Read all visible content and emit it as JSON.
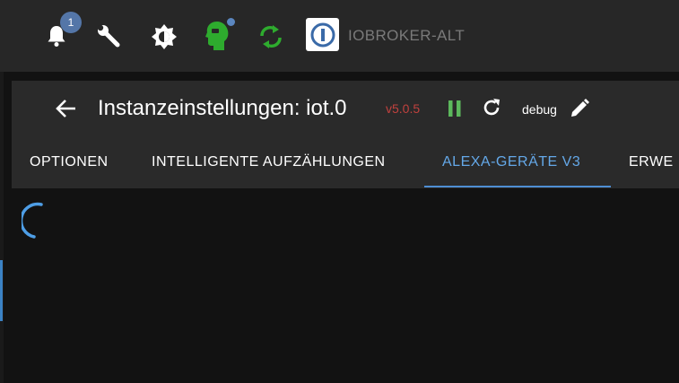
{
  "topbar": {
    "notifications_count": "1",
    "brand": "IOBROKER-ALT",
    "icons": [
      "bell-icon",
      "wrench-icon",
      "brightness-icon",
      "expert-mode-icon",
      "update-sync-icon",
      "iobroker-logo"
    ]
  },
  "instance": {
    "title": "Instanzeinstellungen: iot.0",
    "version": "v5.0.5",
    "loglevel": "debug"
  },
  "tabs": [
    {
      "label": "OPTIONEN",
      "active": false
    },
    {
      "label": "INTELLIGENTE AUFZÄHLUNGEN",
      "active": false
    },
    {
      "label": "ALEXA-GERÄTE V3",
      "active": true
    },
    {
      "label": "ERWE",
      "active": false
    }
  ],
  "colors": {
    "accent": "#4e8ed3",
    "version": "#c0413e",
    "pause": "#5cb85c",
    "green_icons": "#2eab2e"
  }
}
